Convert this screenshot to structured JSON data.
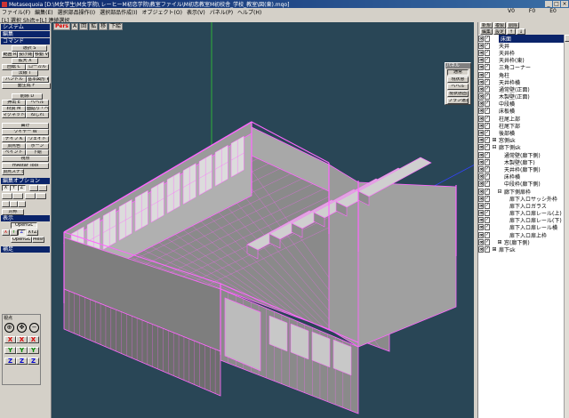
{
  "window": {
    "title": "Metasequoia [D:\\M女学生\\M女学院\\ レーヒーM初恋学院\\教室ファイル\\M初恋教室M初校舎_学校_教室\\図(東).mqo]",
    "controls": [
      "_",
      "□",
      "×"
    ]
  },
  "menu": {
    "items": [
      "ファイル(F)",
      "編集(E)",
      "選択部品操作(I)",
      "選択部品作成(I)",
      "オブジェクト(O)",
      "表示(V)",
      "パネル(P)",
      "ヘルプ(H)"
    ],
    "right": [
      "V0",
      "F0",
      "E0"
    ]
  },
  "status": "[L] 選択  Shift+[L] 連続選択",
  "left": {
    "system_header": "システム",
    "edit_header": "編集",
    "command_header": "コマンド",
    "buttons": [
      {
        "label": "選択 S",
        "on": false
      },
      {
        "label": "範囲 R",
        "on": false
      },
      {
        "label": "投げ縄 L",
        "on": false
      },
      {
        "label": "移動 V",
        "on": false
      },
      {
        "label": "拡大 X",
        "on": false
      },
      {
        "label": "回転 C",
        "on": false
      },
      {
        "label": "ローカル",
        "on": false
      },
      {
        "label": "法線 T",
        "on": false
      },
      {
        "label": "ハンドル",
        "on": false
      },
      {
        "label": "基本図形 P",
        "on": false
      },
      {
        "label": "面生成 F",
        "on": false
      },
      {
        "label": "削除 D",
        "on": false
      },
      {
        "label": "押出 E",
        "on": false
      },
      {
        "label": "ベベル",
        "on": false
      },
      {
        "label": "材質 M",
        "on": false
      },
      {
        "label": "面貼り・ベベル",
        "on": false
      },
      {
        "label": "マグネット",
        "on": false
      },
      {
        "label": "ねじれ",
        "on": false
      },
      {
        "label": "曲げ",
        "on": false
      },
      {
        "label": "ワイヤー W",
        "on": false
      },
      {
        "label": "ナイフ K",
        "on": false
      },
      {
        "label": "ウェイト",
        "on": false
      },
      {
        "label": "頂点色",
        "on": false
      },
      {
        "label": "ボーン",
        "on": false
      },
      {
        "label": "ペイント",
        "on": false
      },
      {
        "label": "下絵",
        "on": false
      },
      {
        "label": "視点",
        "on": false
      },
      {
        "label": "mAstar Tool",
        "on": false
      },
      {
        "label": "頂点スナップ",
        "on": false
      }
    ],
    "editopt_header": "編集オプション",
    "editopt_row1": [
      "X",
      "Y",
      "Z",
      "",
      ""
    ],
    "editopt_row2": [
      "",
      "",
      "",
      ""
    ],
    "editopt_row3": [
      "",
      "",
      "",
      "",
      ""
    ],
    "editopt_sym": "対称",
    "display_header": "表示",
    "opengl_label": "OpenGL",
    "opengl2_label": "OpenGL",
    "mesh_label": "Mesh",
    "axis_labels": [
      "X",
      "Y",
      "Z",
      "XYZ"
    ],
    "misc_header": "補足",
    "gizmo_title": "視点",
    "gizmo_rows": [
      [
        "X",
        "X",
        "X"
      ],
      [
        "Y",
        "Y",
        "Y"
      ],
      [
        "Z",
        "Z",
        "Z"
      ]
    ]
  },
  "viewport": {
    "tabs": [
      {
        "label": "Pers",
        "name": "pers"
      },
      {
        "label": "A",
        "name": "a"
      },
      {
        "label": "回",
        "name": "kai"
      },
      {
        "label": "拡",
        "name": "kaku"
      },
      {
        "label": "移",
        "name": "ido"
      },
      {
        "label": "下絵",
        "name": "shitae"
      }
    ],
    "bg": "#294656",
    "mesh_fill": "#9a9a9a",
    "mesh_edge": "#ff66ff"
  },
  "float_palette": {
    "title": "パネル",
    "buttons": [
      {
        "label": "通常",
        "on": true
      },
      {
        "label": "現状態",
        "on": false
      },
      {
        "label": "ベベル",
        "on": false
      },
      {
        "label": "現状態固",
        "on": false
      },
      {
        "label": "プラン選択",
        "on": false
      }
    ]
  },
  "objects": {
    "top_buttons": [
      "新規",
      "複製",
      "削除",
      "編集",
      "設定",
      "↑",
      "↓"
    ],
    "items": [
      {
        "name": "床面",
        "sel": true,
        "v": true,
        "l": true,
        "tw": "",
        "indent": 0
      },
      {
        "name": "天井",
        "sel": false,
        "v": true,
        "l": true,
        "tw": "",
        "indent": 0
      },
      {
        "name": "天井枠",
        "sel": false,
        "v": true,
        "l": true,
        "tw": "",
        "indent": 0
      },
      {
        "name": "天井枠(東)",
        "sel": false,
        "v": true,
        "l": true,
        "tw": "",
        "indent": 0
      },
      {
        "name": "三角コーナー",
        "sel": false,
        "v": true,
        "l": true,
        "tw": "",
        "indent": 0
      },
      {
        "name": "角柱",
        "sel": false,
        "v": true,
        "l": true,
        "tw": "",
        "indent": 0
      },
      {
        "name": "天井枠横",
        "sel": false,
        "v": true,
        "l": true,
        "tw": "",
        "indent": 0
      },
      {
        "name": "通常壁(正面)",
        "sel": false,
        "v": true,
        "l": true,
        "tw": "",
        "indent": 0
      },
      {
        "name": "木製壁(正面)",
        "sel": false,
        "v": true,
        "l": true,
        "tw": "",
        "indent": 0
      },
      {
        "name": "中段横",
        "sel": false,
        "v": true,
        "l": true,
        "tw": "",
        "indent": 0
      },
      {
        "name": "床板横",
        "sel": false,
        "v": true,
        "l": true,
        "tw": "",
        "indent": 0
      },
      {
        "name": "柱尾上部",
        "sel": false,
        "v": true,
        "l": true,
        "tw": "",
        "indent": 0
      },
      {
        "name": "柱尾下部",
        "sel": false,
        "v": true,
        "l": true,
        "tw": "",
        "indent": 0
      },
      {
        "name": "後部横",
        "sel": false,
        "v": true,
        "l": true,
        "tw": "",
        "indent": 0
      },
      {
        "name": "窓側sk",
        "sel": false,
        "v": true,
        "l": true,
        "tw": "⊞",
        "indent": 0
      },
      {
        "name": "廊下側sk",
        "sel": false,
        "v": true,
        "l": true,
        "tw": "⊟",
        "indent": 0
      },
      {
        "name": "通常壁(廊下側)",
        "sel": false,
        "v": true,
        "l": true,
        "tw": "",
        "indent": 1
      },
      {
        "name": "木製壁(廊下)",
        "sel": false,
        "v": true,
        "l": true,
        "tw": "",
        "indent": 1
      },
      {
        "name": "天井枠(廊下側)",
        "sel": false,
        "v": true,
        "l": true,
        "tw": "",
        "indent": 1
      },
      {
        "name": "床枠横",
        "sel": false,
        "v": true,
        "l": true,
        "tw": "",
        "indent": 1
      },
      {
        "name": "中段枠(廊下側)",
        "sel": false,
        "v": true,
        "l": true,
        "tw": "",
        "indent": 1
      },
      {
        "name": "廊下側扉枠",
        "sel": false,
        "v": true,
        "l": true,
        "tw": "⊟",
        "indent": 1
      },
      {
        "name": "扉下入ロサッシ外枠",
        "sel": false,
        "v": true,
        "l": true,
        "tw": "",
        "indent": 2
      },
      {
        "name": "扉下入ロガラス",
        "sel": false,
        "v": true,
        "l": true,
        "tw": "",
        "indent": 2
      },
      {
        "name": "扉下入ロ扉レール(上)",
        "sel": false,
        "v": true,
        "l": true,
        "tw": "",
        "indent": 2
      },
      {
        "name": "扉下入ロ扉レール(下)",
        "sel": false,
        "v": true,
        "l": true,
        "tw": "",
        "indent": 2
      },
      {
        "name": "扉下入ロ扉レール横",
        "sel": false,
        "v": true,
        "l": true,
        "tw": "",
        "indent": 2
      },
      {
        "name": "扉下入ロ扉上枠",
        "sel": false,
        "v": true,
        "l": true,
        "tw": "",
        "indent": 2
      },
      {
        "name": "窓(廊下側)",
        "sel": false,
        "v": true,
        "l": true,
        "tw": "⊞",
        "indent": 1
      },
      {
        "name": "扉下sk",
        "sel": false,
        "v": true,
        "l": true,
        "tw": "⊞",
        "indent": 0
      }
    ]
  }
}
